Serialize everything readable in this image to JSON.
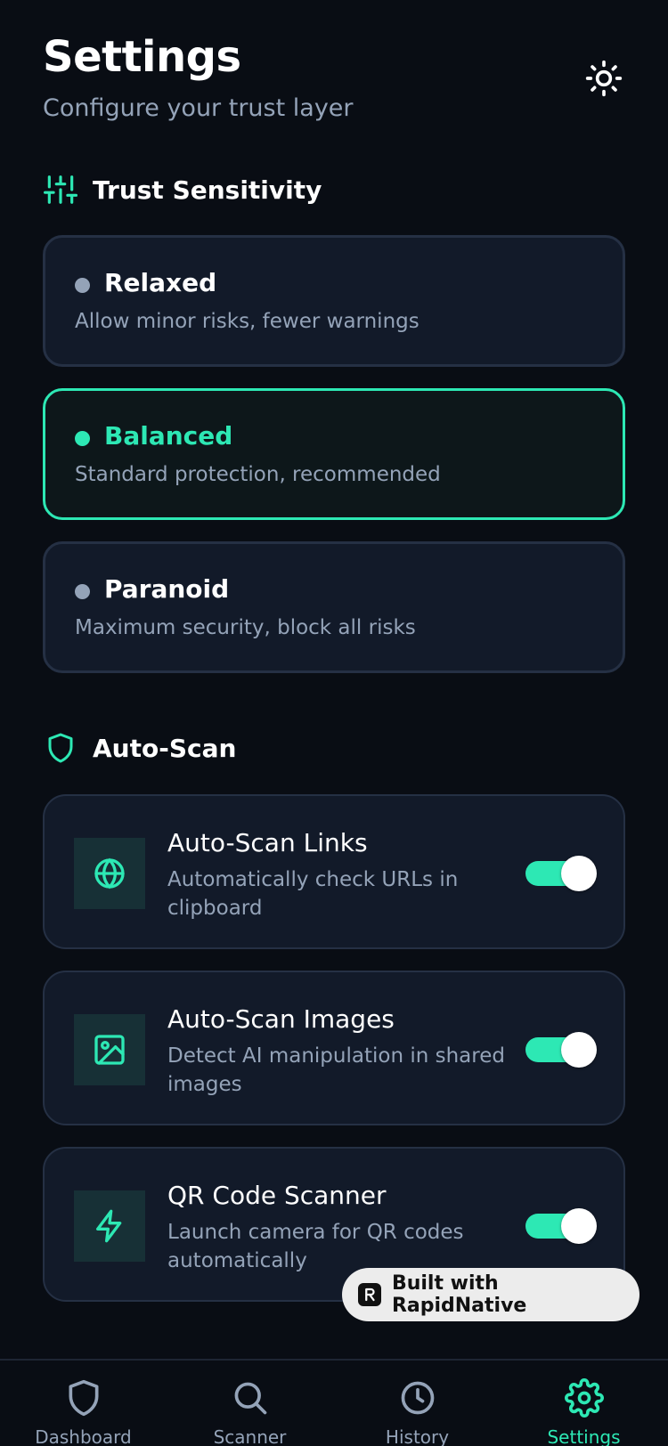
{
  "header": {
    "title": "Settings",
    "subtitle": "Configure your trust layer",
    "theme_icon": "sun-icon"
  },
  "sections": {
    "trust": {
      "label": "Trust Sensitivity",
      "icon": "sliders-icon"
    },
    "auto_scan": {
      "label": "Auto-Scan",
      "icon": "shield-icon"
    }
  },
  "sensitivity_options": [
    {
      "title": "Relaxed",
      "description": "Allow minor risks, fewer warnings",
      "selected": false
    },
    {
      "title": "Balanced",
      "description": "Standard protection, recommended",
      "selected": true
    },
    {
      "title": "Paranoid",
      "description": "Maximum security, block all risks",
      "selected": false
    }
  ],
  "auto_scan_settings": [
    {
      "title": "Auto-Scan Links",
      "description": "Automatically check URLs in clipboard",
      "icon": "globe-icon",
      "enabled": true
    },
    {
      "title": "Auto-Scan Images",
      "description": "Detect AI manipulation in shared images",
      "icon": "image-icon",
      "enabled": true
    },
    {
      "title": "QR Code Scanner",
      "description": "Launch camera for QR codes automatically",
      "icon": "lightning-icon",
      "enabled": true
    }
  ],
  "badge": {
    "label": "Built with RapidNative",
    "icon": "rapidnative-logo"
  },
  "bottom_nav": [
    {
      "label": "Dashboard",
      "icon": "shield-icon",
      "active": false
    },
    {
      "label": "Scanner",
      "icon": "search-icon",
      "active": false
    },
    {
      "label": "History",
      "icon": "clock-icon",
      "active": false
    },
    {
      "label": "Settings",
      "icon": "gear-icon",
      "active": true
    }
  ],
  "colors": {
    "background": "#090D14",
    "card": "#121A29",
    "accent": "#2DE8B4",
    "muted_text": "#94A3B8"
  }
}
